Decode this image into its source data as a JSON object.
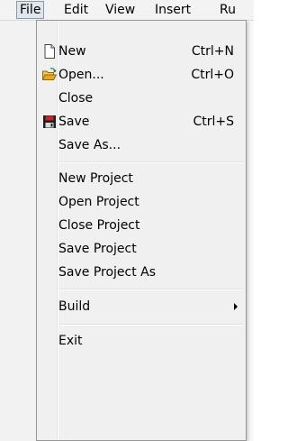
{
  "menubar": {
    "items": [
      "File",
      "Edit",
      "View",
      "Insert",
      "Ru"
    ]
  },
  "file_menu": {
    "items": [
      {
        "label": "New",
        "shortcut": "Ctrl+N",
        "icon": "new-document-icon"
      },
      {
        "label": "Open...",
        "shortcut": "Ctrl+O",
        "icon": "open-folder-icon"
      },
      {
        "label": "Close",
        "shortcut": ""
      },
      {
        "label": "Save",
        "shortcut": "Ctrl+S",
        "icon": "floppy-disk-icon"
      },
      {
        "label": "Save As...",
        "shortcut": ""
      },
      {
        "label": "New Project",
        "shortcut": ""
      },
      {
        "label": "Open Project",
        "shortcut": ""
      },
      {
        "label": "Close Project",
        "shortcut": ""
      },
      {
        "label": "Save Project",
        "shortcut": ""
      },
      {
        "label": "Save Project As",
        "shortcut": ""
      },
      {
        "label": "Build",
        "shortcut": "",
        "submenu": true,
        "icon": "submenu-arrow-icon"
      },
      {
        "label": "Exit",
        "shortcut": ""
      }
    ]
  },
  "colors": {
    "menu_background": "#f0f0f0",
    "active_menubar_item": "#dfe5ec",
    "folder_icon": "#e8b83a",
    "floppy_icon": "#c0262b"
  }
}
